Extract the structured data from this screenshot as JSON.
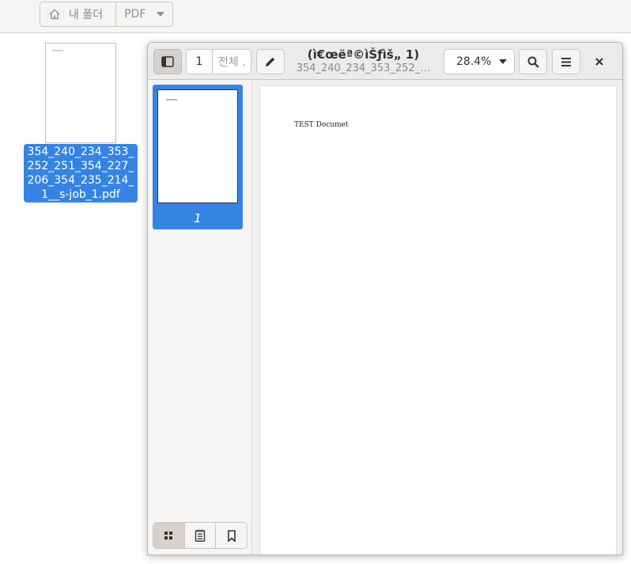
{
  "file_manager": {
    "breadcrumbs": [
      "내 폴더",
      "PDF"
    ],
    "file_label": "354_240_234_353_252_251_354_227_206_354_235_214_1__s-job_1.pdf"
  },
  "viewer": {
    "current_page": "1",
    "page_total_placeholder": "전체 .",
    "title": "(ì€œëª©ìŠƒìš„ 1)",
    "subtitle": "354_240_234_353_252_…",
    "zoom": "28.4%",
    "thumbnail_page_number": "1",
    "document_text": "TEST Documet"
  },
  "colors": {
    "accent": "#3584e4",
    "headerbar": "#ebebeb"
  },
  "icons": [
    "home-icon",
    "chevron-down-icon",
    "sidebar-toggle-icon",
    "pencil-icon",
    "search-icon",
    "menu-icon",
    "close-icon",
    "thumbnails-icon",
    "outline-icon",
    "bookmark-icon"
  ]
}
